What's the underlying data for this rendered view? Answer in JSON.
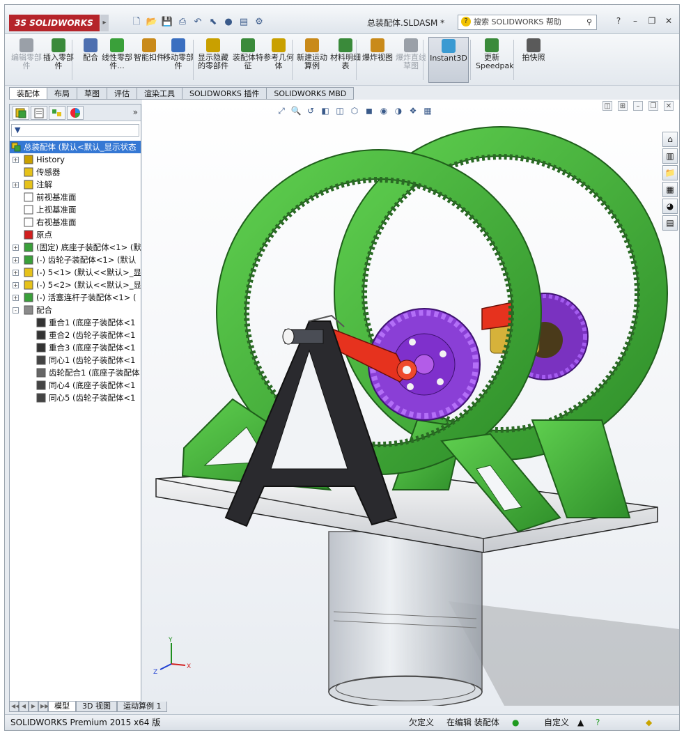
{
  "window": {
    "logo": "3S SOLIDWORKS",
    "title": "总装配体.SLDASM *",
    "help_search_placeholder": "搜索 SOLIDWORKS 帮助"
  },
  "ribbon": {
    "buttons": [
      {
        "label": "编辑零部件",
        "enabled": false
      },
      {
        "label": "插入零部件",
        "enabled": true
      },
      {
        "label": "配合",
        "enabled": true
      },
      {
        "label": "线性零部件...",
        "enabled": true
      },
      {
        "label": "智能扣件",
        "enabled": true
      },
      {
        "label": "移动零部件",
        "enabled": true
      },
      {
        "label": "显示隐藏的零部件",
        "enabled": true
      },
      {
        "label": "装配体特征",
        "enabled": true
      },
      {
        "label": "参考几何体",
        "enabled": true
      },
      {
        "label": "新建运动算例",
        "enabled": true
      },
      {
        "label": "材料明细表",
        "enabled": true
      },
      {
        "label": "爆炸视图",
        "enabled": true
      },
      {
        "label": "爆炸直线草图",
        "enabled": false
      },
      {
        "label": "Instant3D",
        "enabled": true,
        "active": true
      },
      {
        "label": "更新Speedpak",
        "enabled": true
      },
      {
        "label": "拍快照",
        "enabled": true
      }
    ]
  },
  "command_tabs": [
    "装配体",
    "布局",
    "草图",
    "评估",
    "渲染工具",
    "SOLIDWORKS 插件",
    "SOLIDWORKS MBD"
  ],
  "feature_tree": {
    "root": "总装配体 (默认<默认_显示状态",
    "nodes": [
      {
        "label": "History",
        "level": 1,
        "expand": "+",
        "icon": "history-icon"
      },
      {
        "label": "传感器",
        "level": 1,
        "expand": "",
        "icon": "sensor-icon"
      },
      {
        "label": "注解",
        "level": 1,
        "expand": "+",
        "icon": "annotation-icon"
      },
      {
        "label": "前视基准面",
        "level": 1,
        "expand": "",
        "icon": "plane-icon"
      },
      {
        "label": "上视基准面",
        "level": 1,
        "expand": "",
        "icon": "plane-icon"
      },
      {
        "label": "右视基准面",
        "level": 1,
        "expand": "",
        "icon": "plane-icon"
      },
      {
        "label": "原点",
        "level": 1,
        "expand": "",
        "icon": "origin-icon"
      },
      {
        "label": "(固定) 底座子装配体<1> (默",
        "level": 1,
        "expand": "+",
        "icon": "subassembly-icon"
      },
      {
        "label": "(-) 齿轮子装配体<1> (默认",
        "level": 1,
        "expand": "+",
        "icon": "subassembly-icon"
      },
      {
        "label": "(-) 5<1> (默认<<默认>_显",
        "level": 1,
        "expand": "+",
        "icon": "part-icon"
      },
      {
        "label": "(-) 5<2> (默认<<默认>_显",
        "level": 1,
        "expand": "+",
        "icon": "part-icon"
      },
      {
        "label": "(-) 活塞连杆子装配体<1> (",
        "level": 1,
        "expand": "+",
        "icon": "subassembly-icon"
      },
      {
        "label": "配合",
        "level": 1,
        "expand": "-",
        "icon": "mates-icon"
      },
      {
        "label": "重合1 (底座子装配体<1",
        "level": 2,
        "expand": "",
        "icon": "coincident-icon"
      },
      {
        "label": "重合2 (齿轮子装配体<1",
        "level": 2,
        "expand": "",
        "icon": "coincident-icon"
      },
      {
        "label": "重合3 (底座子装配体<1",
        "level": 2,
        "expand": "",
        "icon": "coincident-icon"
      },
      {
        "label": "同心1 (齿轮子装配体<1",
        "level": 2,
        "expand": "",
        "icon": "concentric-icon"
      },
      {
        "label": "齿轮配合1 (底座子装配体",
        "level": 2,
        "expand": "",
        "icon": "gear-mate-icon"
      },
      {
        "label": "同心4 (底座子装配体<1",
        "level": 2,
        "expand": "",
        "icon": "concentric-icon"
      },
      {
        "label": "同心5 (齿轮子装配体<1",
        "level": 2,
        "expand": "",
        "icon": "concentric-icon"
      }
    ]
  },
  "bottom_tabs": [
    "模型",
    "3D 视图",
    "运动算例 1"
  ],
  "status_bar": {
    "product": "SOLIDWORKS Premium 2015 x64 版",
    "definition": "欠定义",
    "editing": "在编辑 装配体",
    "units": "自定义"
  },
  "colors": {
    "gear_green": "#3fae3a",
    "gear_purple": "#8a3fd6",
    "connecting_rod_red": "#e6321e",
    "selection_blue": "#3578d4"
  }
}
